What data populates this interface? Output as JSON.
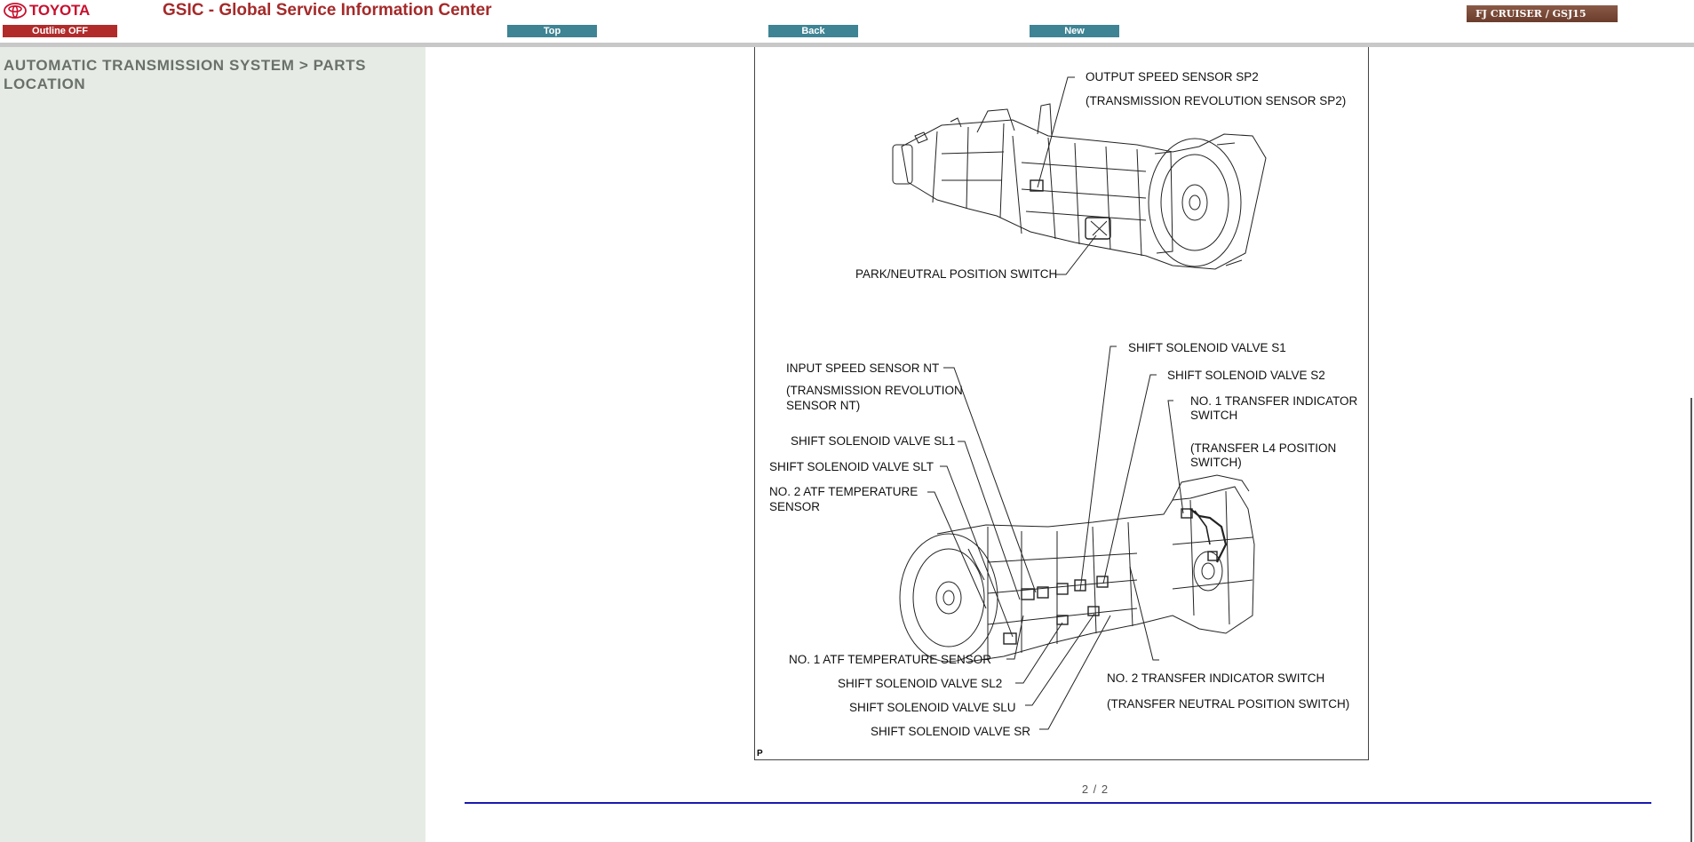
{
  "header": {
    "brand": "TOYOTA",
    "title": "GSIC - Global Service Information Center",
    "outline_label": "Outline OFF",
    "nav": {
      "top": "Top",
      "back": "Back",
      "new": "New"
    },
    "model": "FJ CRUISER / GSJ15"
  },
  "sidebar": {
    "breadcrumb": "AUTOMATIC TRANSMISSION SYSTEM > PARTS LOCATION"
  },
  "figure": {
    "corner_mark": "P",
    "labels": {
      "output_speed_sensor": "OUTPUT SPEED SENSOR SP2",
      "output_speed_sensor_alt": "(TRANSMISSION REVOLUTION SENSOR SP2)",
      "park_neutral": "PARK/NEUTRAL POSITION SWITCH",
      "shift_s1": "SHIFT SOLENOID VALVE S1",
      "input_speed_sensor": "INPUT SPEED SENSOR NT",
      "shift_s2": "SHIFT SOLENOID VALVE S2",
      "input_alt_1": "(TRANSMISSION REVOLUTION",
      "input_alt_2": "SENSOR NT)",
      "transfer_1_a": "NO. 1 TRANSFER INDICATOR",
      "transfer_1_b": "SWITCH",
      "shift_sl1": "SHIFT SOLENOID VALVE SL1",
      "transfer_1_alt_a": "(TRANSFER L4 POSITION",
      "transfer_1_alt_b": "SWITCH)",
      "shift_slt": "SHIFT SOLENOID VALVE SLT",
      "atf2_a": "NO. 2 ATF TEMPERATURE",
      "atf2_b": "SENSOR",
      "atf1": "NO. 1 ATF TEMPERATURE SENSOR",
      "transfer_2": "NO. 2 TRANSFER INDICATOR SWITCH",
      "shift_sl2": "SHIFT SOLENOID VALVE SL2",
      "transfer_2_alt": "(TRANSFER NEUTRAL POSITION SWITCH)",
      "shift_slu": "SHIFT SOLENOID VALVE SLU",
      "shift_sr": "SHIFT SOLENOID VALVE SR"
    }
  },
  "footer": {
    "page": "2 / 2"
  },
  "colors": {
    "brand_red": "#c8102e",
    "title_red": "#a52a2a",
    "nav_teal": "#3e8494",
    "outline_red": "#b22b2b",
    "rule_blue": "#1a1ab0"
  }
}
